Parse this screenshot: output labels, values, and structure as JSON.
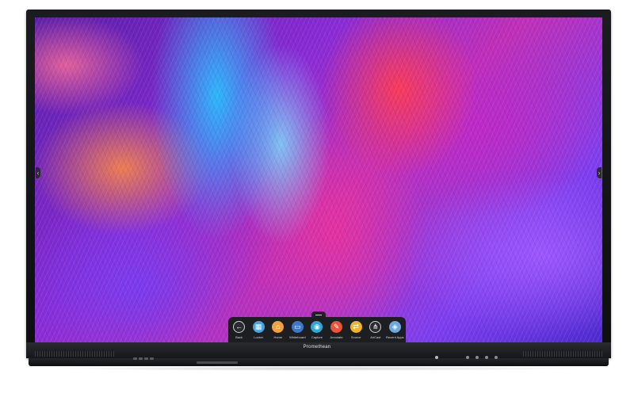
{
  "brand": {
    "name": "Promethean"
  },
  "dock": {
    "items": [
      {
        "label": "Back",
        "icon": "back-arrow-icon",
        "glyph": "←",
        "color": "#2b2c30"
      },
      {
        "label": "Locker",
        "icon": "locker-icon",
        "glyph": "▦",
        "color": "#4aa3df"
      },
      {
        "label": "Home",
        "icon": "home-icon",
        "glyph": "⌂",
        "color": "#f2a23a"
      },
      {
        "label": "Whiteboard",
        "icon": "whiteboard-icon",
        "glyph": "▭",
        "color": "#3b78c9"
      },
      {
        "label": "Capture",
        "icon": "capture-icon",
        "glyph": "◉",
        "color": "#2fa8d8"
      },
      {
        "label": "Annotate",
        "icon": "annotate-icon",
        "glyph": "✎",
        "color": "#e8533a"
      },
      {
        "label": "Source",
        "icon": "source-icon",
        "glyph": "⇄",
        "color": "#f0b429"
      },
      {
        "label": "AirCast",
        "icon": "share-icon",
        "glyph": "⋔",
        "color": "#2b2c30"
      },
      {
        "label": "Recent Apps",
        "icon": "recent-apps-icon",
        "glyph": "◈",
        "color": "#6fa8dc"
      }
    ]
  },
  "side_tabs": {
    "left_glyph": "‹",
    "right_glyph": "›"
  }
}
